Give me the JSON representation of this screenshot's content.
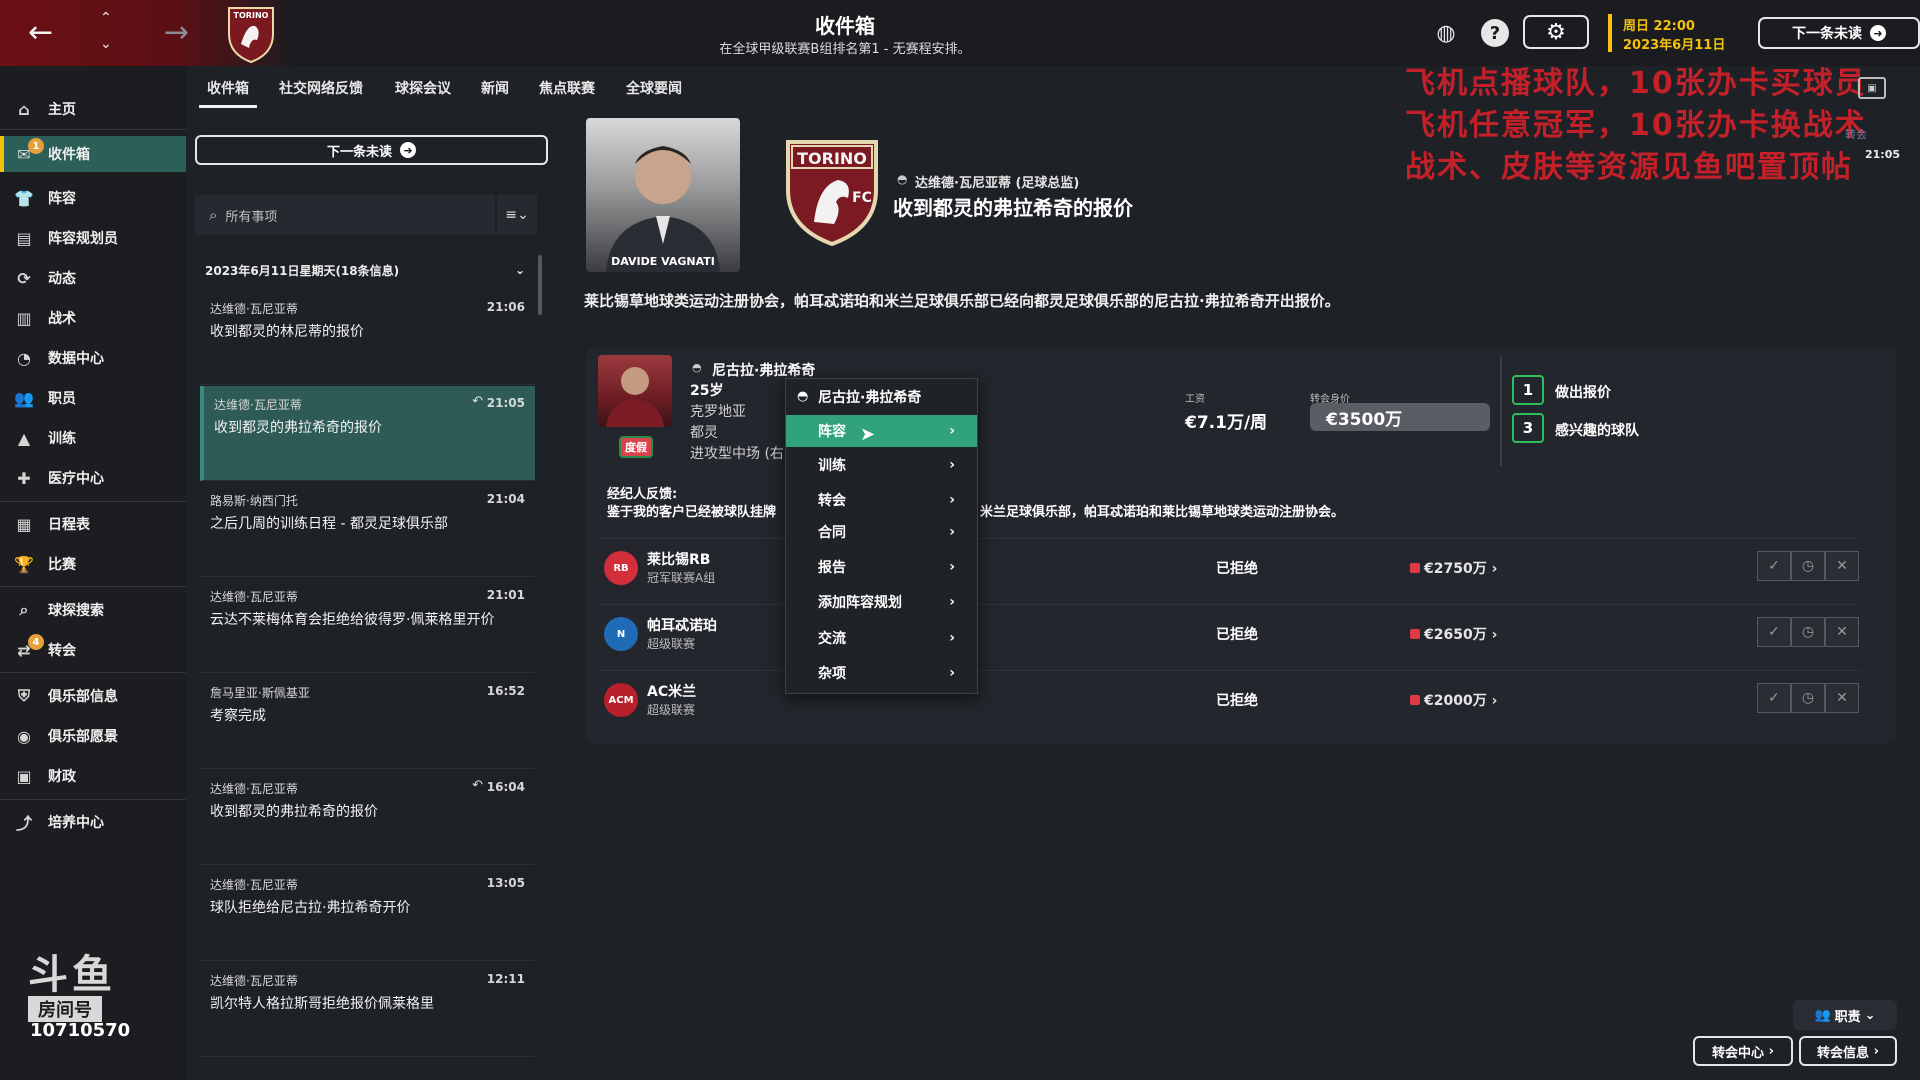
{
  "header": {
    "title": "收件箱",
    "subtitle": "在全球甲级联赛B组排名第1 - 无赛程安排。",
    "date_line1": "周日 22:00",
    "date_line2": "2023年6月11日",
    "next_unread": "下一条未读",
    "club_crest_text": "TORINO FC"
  },
  "overlay_text": {
    "line1": "飞机点播球队，10张办卡买球员",
    "line2": "飞机任意冠军，10张办卡换战术",
    "line3": "战术、皮肤等资源见鱼吧置顶帖"
  },
  "sidebar": {
    "items": [
      {
        "label": "主页",
        "icon": "home-icon"
      },
      {
        "label": "收件箱",
        "icon": "inbox-icon",
        "badge": "1"
      },
      {
        "label": "阵容",
        "icon": "squad-icon"
      },
      {
        "label": "阵容规划员",
        "icon": "clipboard-icon"
      },
      {
        "label": "动态",
        "icon": "dynamics-icon"
      },
      {
        "label": "战术",
        "icon": "tactics-icon"
      },
      {
        "label": "数据中心",
        "icon": "data-icon"
      },
      {
        "label": "职员",
        "icon": "staff-icon"
      },
      {
        "label": "训练",
        "icon": "training-icon"
      },
      {
        "label": "医疗中心",
        "icon": "medical-icon"
      },
      {
        "label": "日程表",
        "icon": "calendar-icon"
      },
      {
        "label": "比赛",
        "icon": "trophy-icon"
      },
      {
        "label": "球探搜索",
        "icon": "search-icon"
      },
      {
        "label": "转会",
        "icon": "transfer-icon",
        "badge": "4"
      },
      {
        "label": "俱乐部信息",
        "icon": "shield-icon"
      },
      {
        "label": "俱乐部愿景",
        "icon": "vision-icon"
      },
      {
        "label": "财政",
        "icon": "finance-icon"
      },
      {
        "label": "培养中心",
        "icon": "development-icon"
      }
    ]
  },
  "tabs": [
    "收件箱",
    "社交网络反馈",
    "球探会议",
    "新闻",
    "焦点联赛",
    "全球要闻"
  ],
  "inbox": {
    "next_unread": "下一条未读",
    "search_placeholder": "所有事项",
    "date_group": "2023年6月11日星期天(18条信息)",
    "messages": [
      {
        "from": "达维德·瓦尼亚蒂",
        "time": "21:06",
        "subject": "收到都灵的林尼蒂的报价"
      },
      {
        "from": "达维德·瓦尼亚蒂",
        "time": "21:05",
        "subject": "收到都灵的弗拉希奇的报价"
      },
      {
        "from": "路易斯·纳西门托",
        "time": "21:04",
        "subject": "之后几周的训练日程 - 都灵足球俱乐部"
      },
      {
        "from": "达维德·瓦尼亚蒂",
        "time": "21:01",
        "subject": "云达不莱梅体育会拒绝给彼得罗·佩莱格里开价"
      },
      {
        "from": "詹马里亚·斯佩基亚",
        "time": "16:52",
        "subject": "考察完成"
      },
      {
        "from": "达维德·瓦尼亚蒂",
        "time": "16:04",
        "subject": "收到都灵的弗拉希奇的报价"
      },
      {
        "from": "达维德·瓦尼亚蒂",
        "time": "13:05",
        "subject": "球队拒绝给尼古拉·弗拉希奇开价"
      },
      {
        "from": "达维德·瓦尼亚蒂",
        "time": "12:11",
        "subject": "凯尔特人格拉斯哥拒绝报价佩莱格里"
      }
    ]
  },
  "message": {
    "photo_caption": "DAVIDE VAGNATI",
    "sender": "达维德·瓦尼亚蒂 (足球总监)",
    "subject": "收到都灵的弗拉希奇的报价",
    "body": "莱比锡草地球类运动注册协会，帕耳忒诺珀和米兰足球俱乐部已经向都灵足球俱乐部的尼古拉·弗拉希奇开出报价。",
    "player": {
      "name": "尼古拉·弗拉希奇",
      "age": "25岁",
      "nation": "克罗地亚",
      "club": "都灵",
      "position": "进攻型中场 (右",
      "injury_tag": "度假",
      "wage_label": "工资",
      "wage": "€7.1万/周",
      "value_label": "转会身价",
      "value": "€3500万"
    },
    "actions": [
      {
        "num": "1",
        "label": "做出报价"
      },
      {
        "num": "3",
        "label": "感兴趣的球队"
      }
    ],
    "agent_title": "经纪人反馈:",
    "agent_text_a": "鉴于我的客户已经被球队挂牌",
    "agent_text_b": "米兰足球俱乐部，帕耳忒诺珀和莱比锡草地球类运动注册协会。",
    "offers": [
      {
        "club": "莱比锡RB",
        "league": "冠军联赛A组",
        "status": "已拒绝",
        "fee": "€2750万",
        "logo": "RB",
        "color": "#d22f3a"
      },
      {
        "club": "帕耳忒诺珀",
        "league": "超级联赛",
        "status": "已拒绝",
        "fee": "€2650万",
        "logo": "N",
        "color": "#1f6bb5"
      },
      {
        "club": "AC米兰",
        "league": "超级联赛",
        "status": "已拒绝",
        "fee": "€2000万",
        "logo": "ACM",
        "color": "#b8202c"
      }
    ]
  },
  "context_menu": {
    "header": "尼古拉·弗拉希奇",
    "items": [
      "阵容",
      "训练",
      "转会",
      "合同",
      "报告",
      "添加阵容规划",
      "交流",
      "杂项"
    ]
  },
  "right_panel": {
    "transfer_label": "转会",
    "time": "21:05"
  },
  "bottom": {
    "staff": "职责",
    "transfer_centre": "转会中心",
    "transfer_info": "转会信息"
  },
  "stream": {
    "logo_text": "斗鱼",
    "room_label": "房间号",
    "room_number": "10710570"
  }
}
